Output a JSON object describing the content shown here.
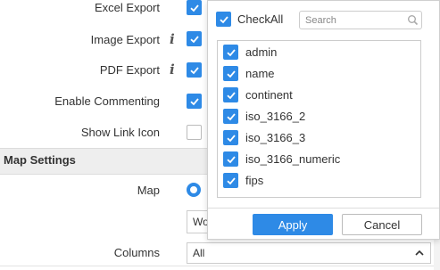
{
  "settings": {
    "rows": [
      {
        "label": "Excel Export",
        "checked": true,
        "info": false
      },
      {
        "label": "Image Export",
        "checked": true,
        "info": true
      },
      {
        "label": "PDF Export",
        "checked": true,
        "info": true
      },
      {
        "label": "Enable Commenting",
        "checked": true,
        "info": false
      },
      {
        "label": "Show Link Icon",
        "checked": false,
        "info": false
      }
    ],
    "info_glyph": "i"
  },
  "map_settings": {
    "section_title": "Map Settings",
    "map_label": "Map",
    "map_select_value": "Wo",
    "columns_label": "Columns",
    "columns_value": "All"
  },
  "popup": {
    "checkall_label": "CheckAll",
    "search_placeholder": "Search",
    "items": [
      {
        "label": "admin",
        "checked": true
      },
      {
        "label": "name",
        "checked": true
      },
      {
        "label": "continent",
        "checked": true
      },
      {
        "label": "iso_3166_2",
        "checked": true
      },
      {
        "label": "iso_3166_3",
        "checked": true
      },
      {
        "label": "iso_3166_numeric",
        "checked": true
      },
      {
        "label": "fips",
        "checked": true
      }
    ],
    "apply_label": "Apply",
    "cancel_label": "Cancel"
  },
  "colors": {
    "accent": "#2e8ae6",
    "section_band": "#eeeeee"
  },
  "icons": [
    "info-icon",
    "checkmark-icon",
    "search-icon",
    "chevron-up-icon",
    "radio-selected-icon"
  ]
}
